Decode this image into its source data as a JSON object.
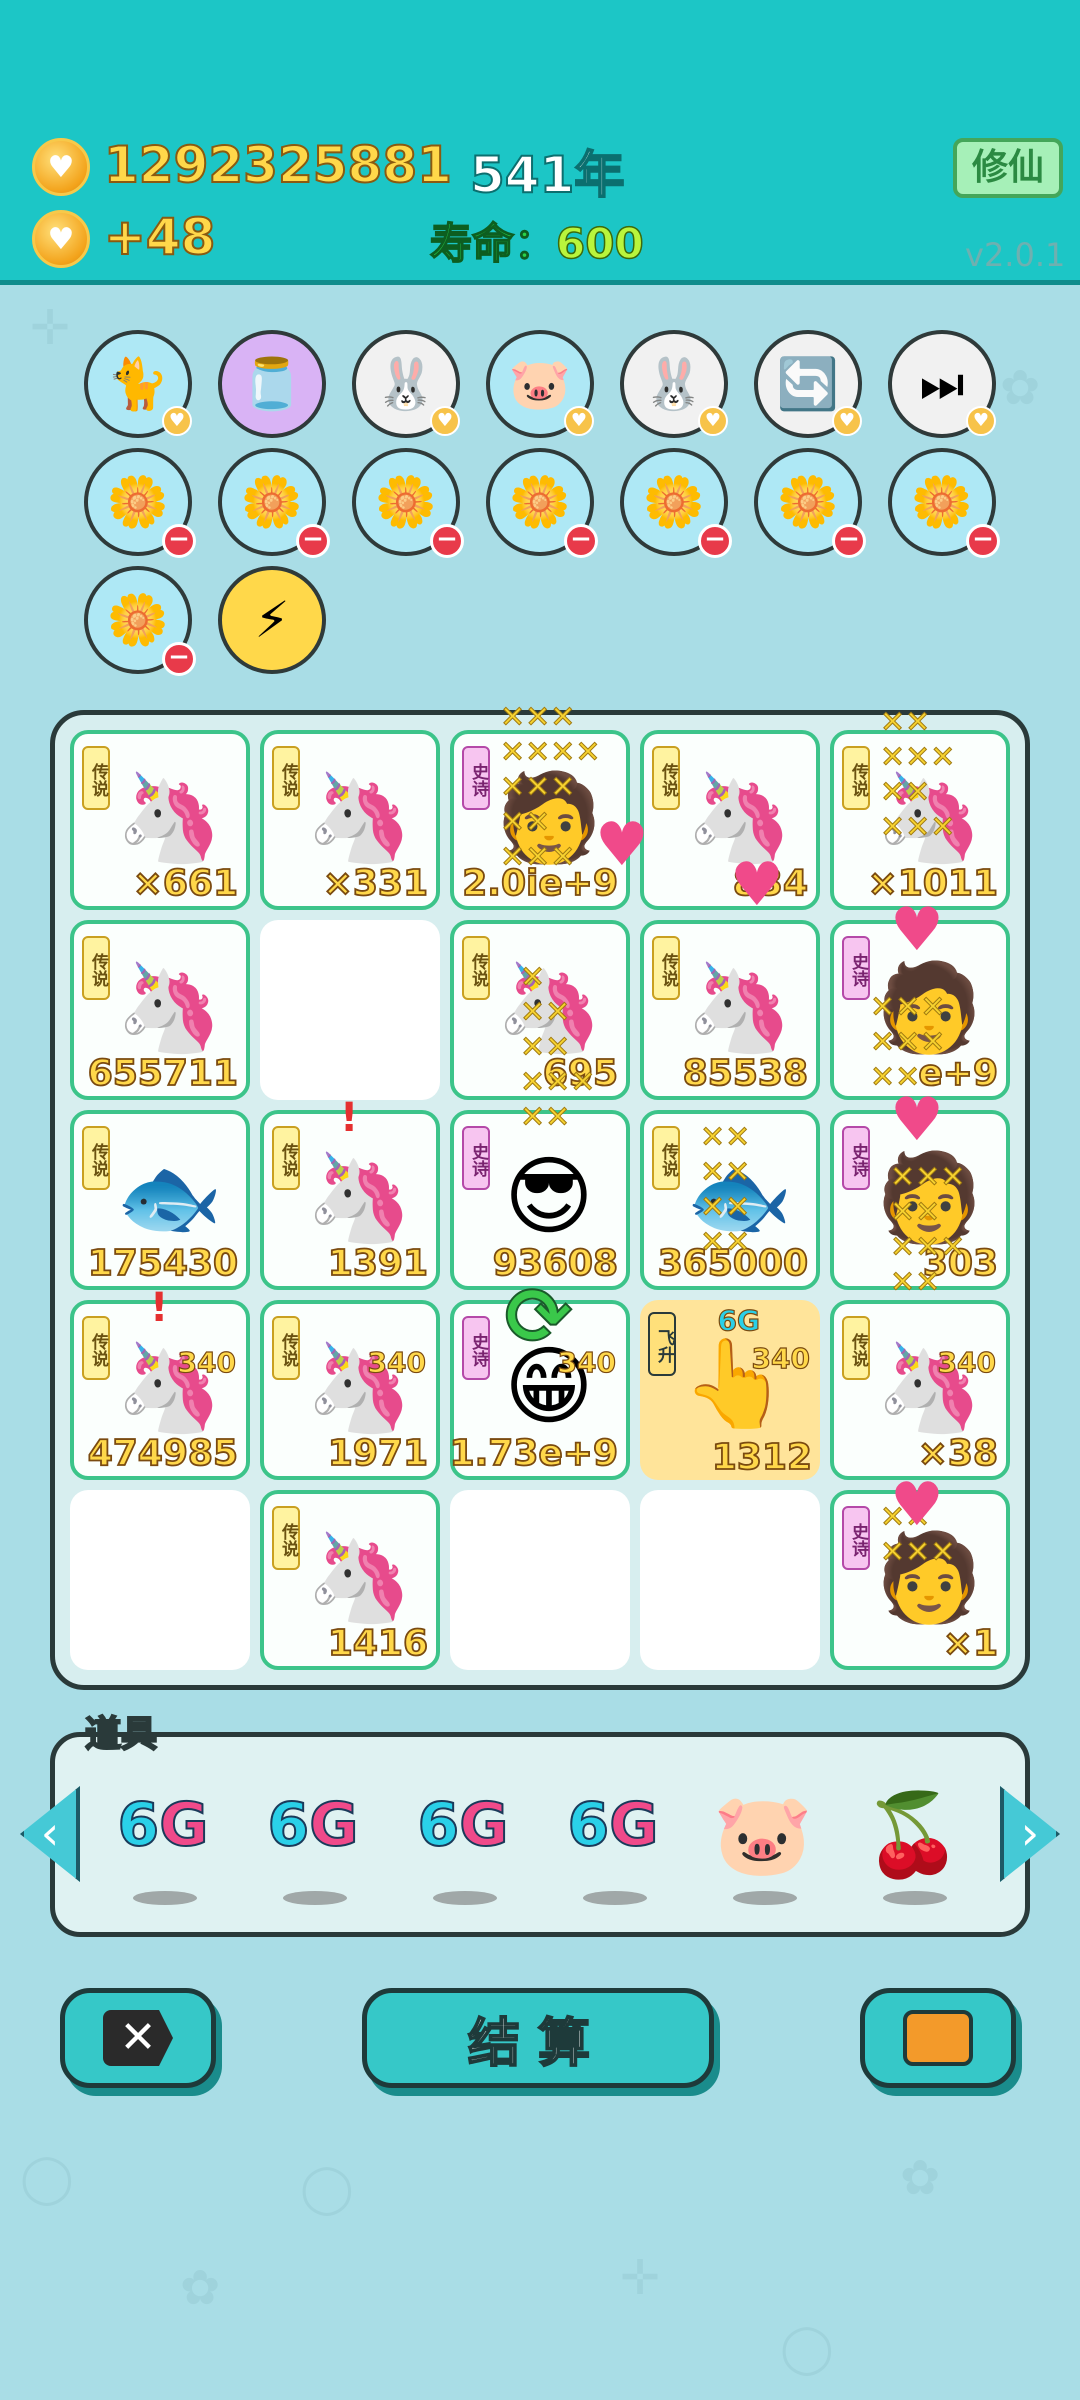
{
  "header": {
    "coins": "1292325881",
    "coin_rate": "+48",
    "year": "541年",
    "life_label": "寿命：",
    "life_value": "600",
    "xiuxian_label": "修仙",
    "version": "v2.0.1"
  },
  "skills_row1": [
    {
      "icon": "cat-icon",
      "glyph": "🐈"
    },
    {
      "icon": "jar-icon",
      "glyph": "🫙"
    },
    {
      "icon": "rabbit-icon",
      "glyph": "🐰"
    },
    {
      "icon": "piggy-bank-icon",
      "glyph": "🐷"
    },
    {
      "icon": "rabbit-icon",
      "glyph": "🐰"
    },
    {
      "icon": "refresh-icon",
      "glyph": "🔄"
    },
    {
      "icon": "skip-icon",
      "glyph": "⏭"
    }
  ],
  "skills_row2": [
    {
      "icon": "flower-pot-icon",
      "glyph": "🌼"
    },
    {
      "icon": "flower-pot-icon",
      "glyph": "🌼"
    },
    {
      "icon": "flower-pot-icon",
      "glyph": "🌼"
    },
    {
      "icon": "flower-pot-icon",
      "glyph": "🌼"
    },
    {
      "icon": "flower-pot-icon",
      "glyph": "🌼"
    },
    {
      "icon": "flower-pot-icon",
      "glyph": "🌼"
    },
    {
      "icon": "flower-pot-icon",
      "glyph": "🌼"
    }
  ],
  "skills_row3": [
    {
      "icon": "flower-pot-icon",
      "glyph": "🌼"
    },
    {
      "icon": "lightning-icon",
      "glyph": "⚡"
    }
  ],
  "grid": [
    {
      "tag": "传说",
      "tag_type": "legend",
      "icon": "unicorn-icon",
      "glyph": "🦄",
      "num": "×661"
    },
    {
      "tag": "传说",
      "tag_type": "legend",
      "icon": "unicorn-icon",
      "glyph": "🦄",
      "num": "×331"
    },
    {
      "tag": "史诗",
      "tag_type": "epic",
      "icon": "character-icon",
      "glyph": "🧑",
      "num": "2.0ie+9"
    },
    {
      "tag": "传说",
      "tag_type": "legend",
      "icon": "unicorn-icon",
      "glyph": "🦄",
      "num": "834"
    },
    {
      "tag": "传说",
      "tag_type": "legend",
      "icon": "unicorn-icon",
      "glyph": "🦄",
      "num": "×1011"
    },
    {
      "tag": "传说",
      "tag_type": "legend",
      "icon": "unicorn-icon",
      "glyph": "🦄",
      "num": "655711"
    },
    {
      "tag": "",
      "tag_type": "",
      "icon": "",
      "glyph": "",
      "num": ""
    },
    {
      "tag": "传说",
      "tag_type": "legend",
      "icon": "unicorn-icon",
      "glyph": "🦄",
      "num": "695"
    },
    {
      "tag": "传说",
      "tag_type": "legend",
      "icon": "unicorn-icon",
      "glyph": "🦄",
      "num": "85538"
    },
    {
      "tag": "史诗",
      "tag_type": "epic",
      "icon": "character-icon",
      "glyph": "🧑",
      "num": "e+9"
    },
    {
      "tag": "传说",
      "tag_type": "legend",
      "icon": "koi-fish-icon",
      "glyph": "🐟",
      "num": "175430"
    },
    {
      "tag": "传说",
      "tag_type": "legend",
      "icon": "unicorn-icon",
      "glyph": "🦄",
      "num": "1391"
    },
    {
      "tag": "史诗",
      "tag_type": "epic",
      "icon": "sunglasses-man-icon",
      "glyph": "😎",
      "num": "93608"
    },
    {
      "tag": "传说",
      "tag_type": "legend",
      "icon": "koi-fish-icon",
      "glyph": "🐟",
      "num": "365000"
    },
    {
      "tag": "史诗",
      "tag_type": "epic",
      "icon": "character-icon",
      "glyph": "🧑",
      "num": "303"
    },
    {
      "tag": "传说",
      "tag_type": "legend",
      "icon": "unicorn-icon",
      "glyph": "🦄",
      "num": "474985",
      "mini": "340"
    },
    {
      "tag": "传说",
      "tag_type": "legend",
      "icon": "unicorn-icon",
      "glyph": "🦄",
      "num": "1971",
      "mini": "340"
    },
    {
      "tag": "史诗",
      "tag_type": "epic",
      "icon": "grinning-man-icon",
      "glyph": "😁",
      "num": "1.73e+9",
      "mini": "340"
    },
    {
      "tag": "飞升",
      "tag_type": "fly",
      "icon": "tap-hand-icon",
      "glyph": "👆",
      "num": "1312",
      "mini": "340",
      "gold": true,
      "label": "6G"
    },
    {
      "tag": "传说",
      "tag_type": "legend",
      "icon": "unicorn-icon",
      "glyph": "🦄",
      "num": "×38",
      "mini": "340"
    },
    {
      "tag": "",
      "tag_type": "",
      "icon": "",
      "glyph": "",
      "num": ""
    },
    {
      "tag": "传说",
      "tag_type": "legend",
      "icon": "unicorn-icon",
      "glyph": "🦄",
      "num": "1416"
    },
    {
      "tag": "",
      "tag_type": "",
      "icon": "",
      "glyph": "",
      "num": ""
    },
    {
      "tag": "",
      "tag_type": "",
      "icon": "",
      "glyph": "",
      "num": ""
    },
    {
      "tag": "史诗",
      "tag_type": "epic",
      "icon": "character-icon",
      "glyph": "🧑",
      "num": "×1"
    }
  ],
  "items": {
    "title": "道具",
    "list": [
      {
        "icon": "6g-icon",
        "label_a": "6",
        "label_b": "G"
      },
      {
        "icon": "6g-icon",
        "label_a": "6",
        "label_b": "G"
      },
      {
        "icon": "6g-icon",
        "label_a": "6",
        "label_b": "G"
      },
      {
        "icon": "6g-icon",
        "label_a": "6",
        "label_b": "G"
      },
      {
        "icon": "piggy-bank-icon",
        "glyph": "🐷"
      },
      {
        "icon": "lychee-icon",
        "glyph": "🍒"
      }
    ]
  },
  "buttons": {
    "settle_label": "结算"
  }
}
